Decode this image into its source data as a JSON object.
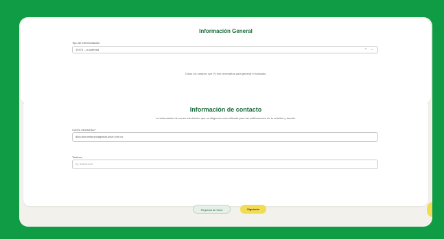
{
  "general": {
    "title": "Información General",
    "request_type_label": "Tipo de intermediación",
    "request_type_value": "19174 – a.sdafrxad",
    "clear_icon": "×",
    "dropdown_icon": "⌄",
    "required_note": "Todos los campos con (*) son necesarios para generar el radicado."
  },
  "contact": {
    "title": "Información de contacto",
    "subtitle": "La información de correo electrónico que se diligencie será utilizada para las notificaciones de la solicitud y tramite.",
    "email_label": "Correo electrónico *",
    "email_value": "dioa.donomita.sndagrasia.unvir.com.co",
    "phone_label": "Teléfono",
    "phone_placeholder": "Ej: 3159XXXX"
  },
  "actions": {
    "back_label": "Regresar al menú",
    "next_label": "Siguiente"
  },
  "colors": {
    "background": "#109b45",
    "accent": "#1c6b3c",
    "button_yellow": "#f2dc55"
  }
}
